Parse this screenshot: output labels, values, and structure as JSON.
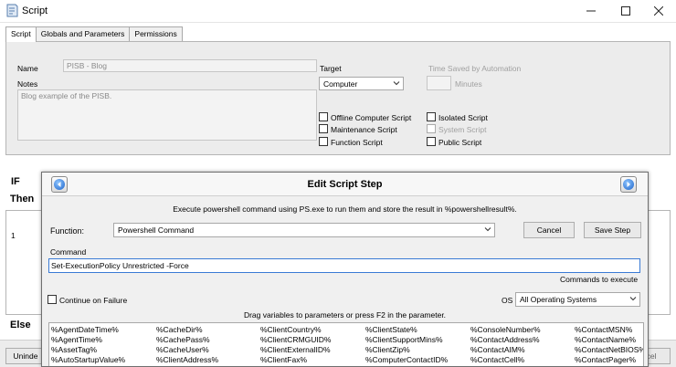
{
  "window": {
    "title": "Script"
  },
  "tabs": [
    "Script",
    "Globals and Parameters",
    "Permissions"
  ],
  "script_tab": {
    "name_label": "Name",
    "name_value": "PISB - Blog",
    "notes_label": "Notes",
    "notes_value": "Blog example of the PISB.",
    "target_label": "Target",
    "target_value": "Computer",
    "time_saved_label": "Time Saved by Automation",
    "minutes_label": "Minutes",
    "checkboxes": {
      "offline": "Offline Computer Script",
      "maintenance": "Maintenance Script",
      "function": "Function Script",
      "isolated": "Isolated Script",
      "system": "System Script",
      "public": "Public Script"
    }
  },
  "sections": {
    "if": "IF",
    "then": "Then",
    "else": "Else",
    "row_number": "1"
  },
  "bottom": {
    "left_button": "Uninde",
    "right_button": "cel"
  },
  "dialog": {
    "title": "Edit Script Step",
    "description": "Execute powershell command using PS.exe to run them and store the result in %powershellresult%.",
    "function_label": "Function:",
    "function_value": "Powershell Command",
    "cancel_label": "Cancel",
    "save_label": "Save Step",
    "command_label": "Command",
    "command_value": "Set-ExecutionPolicy Unrestricted -Force",
    "commands_hint": "Commands to execute",
    "continue_label": "Continue on Failure",
    "os_label": "OS",
    "os_value": "All Operating Systems",
    "drag_hint": "Drag variables to parameters or press F2 in the parameter.",
    "variables": [
      [
        "%AgentDateTime%",
        "%AgentTime%",
        "%AssetTag%",
        "%AutoStartupValue%"
      ],
      [
        "%CacheDir%",
        "%CachePass%",
        "%CacheUser%",
        "%ClientAddress%"
      ],
      [
        "%ClientCountry%",
        "%ClientCRMGUID%",
        "%ClientExternalID%",
        "%ClientFax%"
      ],
      [
        "%ClientState%",
        "%ClientSupportMins%",
        "%ClientZip%",
        "%ComputerContactID%"
      ],
      [
        "%ConsoleNumber%",
        "%ContactAddress%",
        "%ContactAIM%",
        "%ContactCell%"
      ],
      [
        "%ContactMSN%",
        "%ContactName%",
        "%ContactNetBIOS%",
        "%ContactPager%"
      ]
    ]
  }
}
